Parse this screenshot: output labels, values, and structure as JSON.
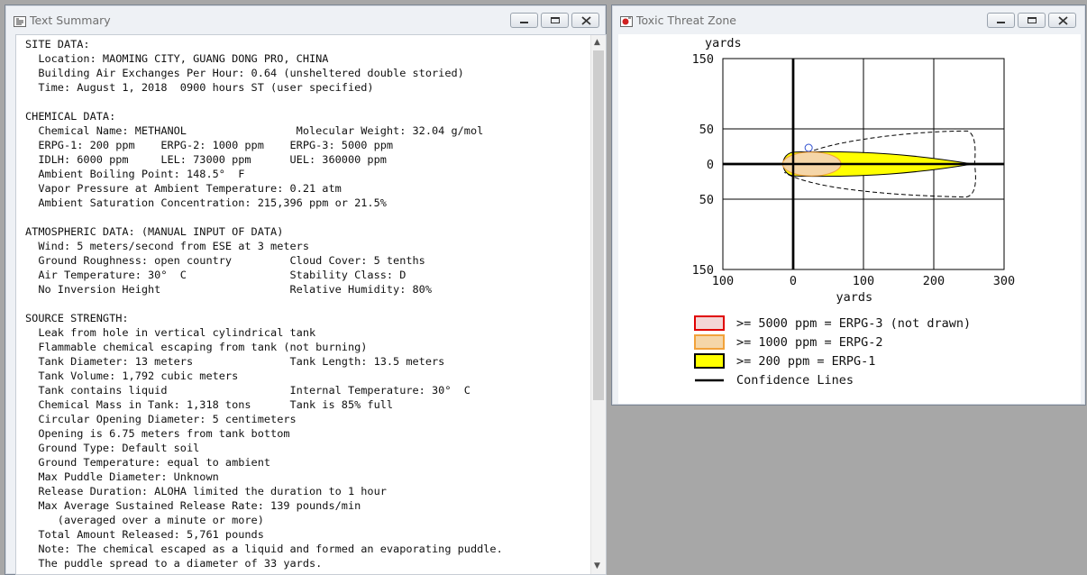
{
  "summary_window": {
    "title": "Text Summary",
    "lines": [
      "SITE DATA:",
      "  Location: MAOMING CITY, GUANG DONG PRO, CHINA",
      "  Building Air Exchanges Per Hour: 0.64 (unsheltered double storied)",
      "  Time: August 1, 2018  0900 hours ST (user specified)",
      "",
      "CHEMICAL DATA:",
      "  Chemical Name: METHANOL                 Molecular Weight: 32.04 g/mol",
      "  ERPG-1: 200 ppm    ERPG-2: 1000 ppm    ERPG-3: 5000 ppm",
      "  IDLH: 6000 ppm     LEL: 73000 ppm      UEL: 360000 ppm",
      "  Ambient Boiling Point: 148.5°  F",
      "  Vapor Pressure at Ambient Temperature: 0.21 atm",
      "  Ambient Saturation Concentration: 215,396 ppm or 21.5%",
      "",
      "ATMOSPHERIC DATA: (MANUAL INPUT OF DATA)",
      "  Wind: 5 meters/second from ESE at 3 meters",
      "  Ground Roughness: open country         Cloud Cover: 5 tenths",
      "  Air Temperature: 30°  C                Stability Class: D",
      "  No Inversion Height                    Relative Humidity: 80%",
      "",
      "SOURCE STRENGTH:",
      "  Leak from hole in vertical cylindrical tank",
      "  Flammable chemical escaping from tank (not burning)",
      "  Tank Diameter: 13 meters               Tank Length: 13.5 meters",
      "  Tank Volume: 1,792 cubic meters",
      "  Tank contains liquid                   Internal Temperature: 30°  C",
      "  Chemical Mass in Tank: 1,318 tons      Tank is 85% full",
      "  Circular Opening Diameter: 5 centimeters",
      "  Opening is 6.75 meters from tank bottom",
      "  Ground Type: Default soil",
      "  Ground Temperature: equal to ambient",
      "  Max Puddle Diameter: Unknown",
      "  Release Duration: ALOHA limited the duration to 1 hour",
      "  Max Average Sustained Release Rate: 139 pounds/min",
      "     (averaged over a minute or more)",
      "  Total Amount Released: 5,761 pounds",
      "  Note: The chemical escaped as a liquid and formed an evaporating puddle.",
      "  The puddle spread to a diameter of 33 yards."
    ]
  },
  "threat_window": {
    "title": "Toxic Threat Zone",
    "y_unit": "yards",
    "x_unit": "yards",
    "y_ticks": [
      "150",
      "50",
      "0",
      "50",
      "150"
    ],
    "x_ticks": [
      "100",
      "0",
      "100",
      "200",
      "300"
    ],
    "legend": [
      {
        "label": ">= 5000 ppm = ERPG-3 (not drawn)",
        "border": "#e00000",
        "fill": "#f3d6d6"
      },
      {
        "label": ">= 1000 ppm = ERPG-2",
        "border": "#f2a23a",
        "fill": "#f5d6a8"
      },
      {
        "label": ">= 200 ppm = ERPG-1",
        "border": "#000000",
        "fill": "#ffff00"
      },
      {
        "label": "Confidence Lines",
        "border": "#000000",
        "fill": ""
      }
    ]
  },
  "chart_data": {
    "type": "area",
    "xlabel": "yards",
    "ylabel": "yards",
    "xlim": [
      -100,
      300
    ],
    "ylim": [
      -150,
      150
    ],
    "x_tick_values": [
      -100,
      0,
      100,
      200,
      300
    ],
    "y_tick_values": [
      150,
      50,
      0,
      -50,
      -150
    ],
    "grid": true,
    "legend_position": "bottom",
    "series": [
      {
        "name": ">= 1000 ppm = ERPG-2",
        "color": "#f5d6a8",
        "x_extent": [
          -15,
          68
        ],
        "y_half_width": 17
      },
      {
        "name": ">= 200 ppm = ERPG-1",
        "color": "#ffff00",
        "x_extent": [
          -15,
          255
        ],
        "y_half_width": 17
      },
      {
        "name": "Confidence Lines",
        "color": "#000000",
        "x_extent": [
          -15,
          255
        ],
        "y_half_width": 47
      }
    ]
  },
  "colors": {
    "erpg1": "#ffff00",
    "erpg2_fill": "#f5d6a8",
    "erpg2_border": "#f2a23a",
    "erpg3_border": "#e00000"
  }
}
